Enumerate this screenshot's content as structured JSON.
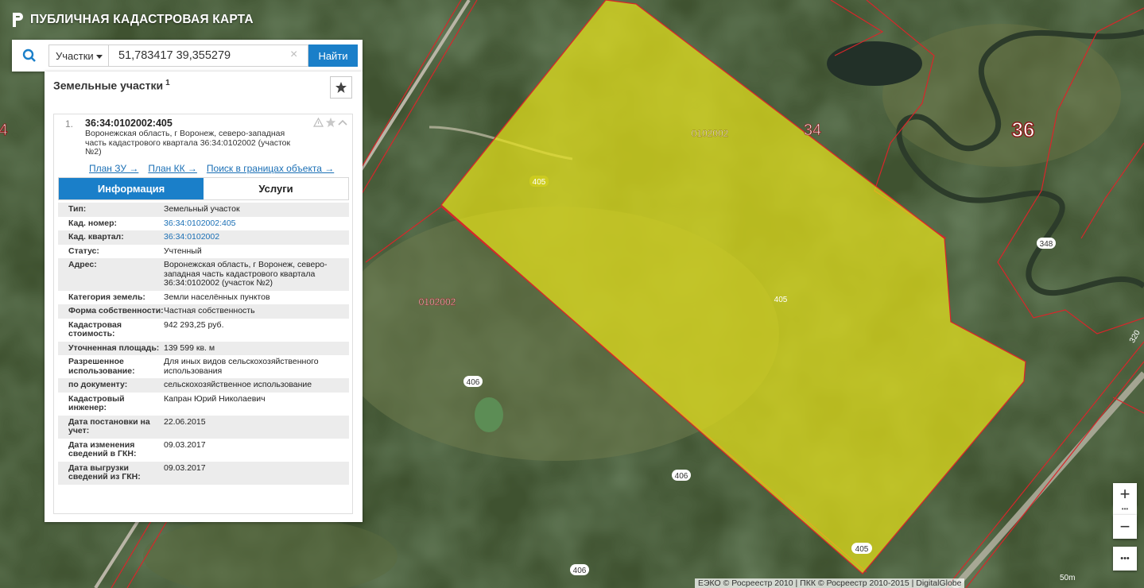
{
  "header": {
    "title": "ПУБЛИЧНАЯ КАДАСТРОВАЯ КАРТА"
  },
  "search": {
    "type_label": "Участки",
    "value": "51,783417 39,355279",
    "clear": "×",
    "button": "Найти"
  },
  "panel": {
    "title": "Земельные участки",
    "count": "1",
    "card": {
      "index": "1.",
      "cad_number": "36:34:0102002:405",
      "address": "Воронежская область, г Воронеж, северо-западная часть кадастрового квартала 36:34:0102002 (участок №2)",
      "links": [
        "План ЗУ →",
        "План КК →",
        "Поиск в границах объекта →"
      ],
      "tabs": [
        "Информация",
        "Услуги"
      ],
      "rows": [
        {
          "k": "Тип:",
          "v": "Земельный участок"
        },
        {
          "k": "Кад. номер:",
          "v": "36:34:0102002:405",
          "link": true
        },
        {
          "k": "Кад. квартал:",
          "v": "36:34:0102002",
          "link": true
        },
        {
          "k": "Статус:",
          "v": "Учтенный"
        },
        {
          "k": "Адрес:",
          "v": "Воронежская область, г Воронеж, северо-западная часть кадастрового квартала 36:34:0102002 (участок №2)"
        },
        {
          "k": "Категория земель:",
          "v": "Земли населённых пунктов"
        },
        {
          "k": "Форма собственности:",
          "v": "Частная собственность"
        },
        {
          "k": "Кадастровая стоимость:",
          "v": "942 293,25 руб."
        },
        {
          "k": "Уточненная площадь:",
          "v": "139 599 кв. м"
        },
        {
          "k": "Разрешенное использование:",
          "v": "Для иных видов сельскохозяйственного использования"
        },
        {
          "k": "по документу:",
          "v": "сельскохозяйственное использование"
        },
        {
          "k": "Кадастровый инженер:",
          "v": "Капран Юрий Николаевич"
        },
        {
          "k": "Дата постановки на учет:",
          "v": "22.06.2015"
        },
        {
          "k": "Дата изменения сведений в ГКН:",
          "v": "09.03.2017"
        },
        {
          "k": "Дата выгрузки сведений из ГКН:",
          "v": "09.03.2017"
        }
      ]
    }
  },
  "map": {
    "labels": {
      "quarter_main": "0102002",
      "quarter_side": "0102002",
      "district": "34",
      "region": "36",
      "region_edge": "4",
      "parcel_405": "405",
      "parcel_406": "406",
      "parcel_348": "348",
      "parcel_320": "320"
    },
    "colors": {
      "parcel_fill": "#e6e21a",
      "boundary": "#d8262a",
      "region_label": "#8b1a1a"
    }
  },
  "controls": {
    "zoom_in": "+",
    "zoom_out": "−",
    "more": "•••"
  },
  "attribution": "ЕЭКО © Росреестр 2010 | ПКК © Росреестр 2010-2015 | DigitalGlobe",
  "scale": "50m"
}
